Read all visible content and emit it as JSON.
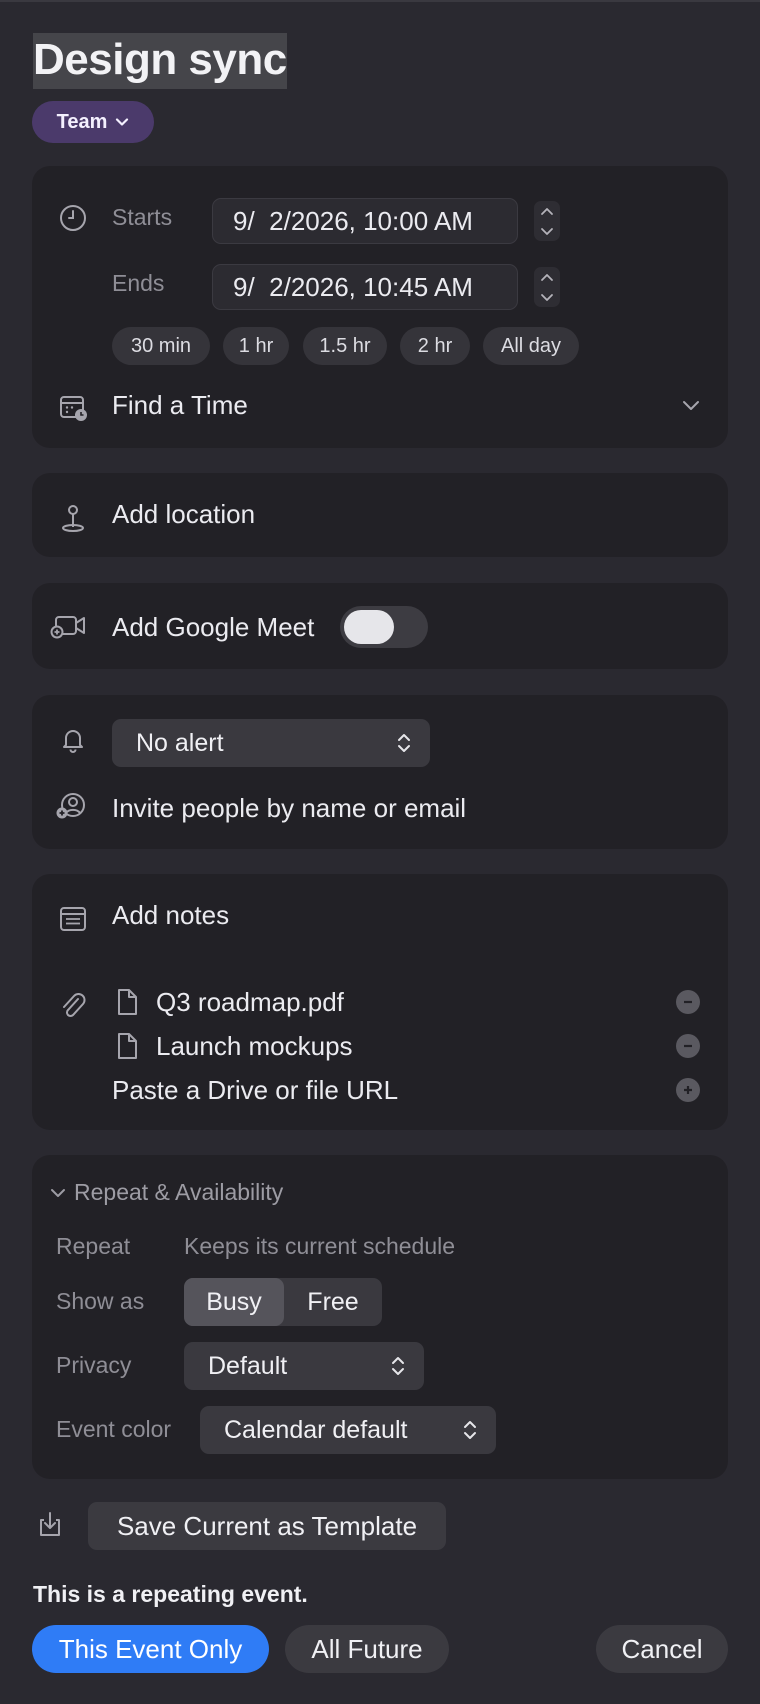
{
  "event": {
    "title": "Design sync",
    "calendar": "Team"
  },
  "time": {
    "starts_label": "Starts",
    "starts_value": "9/  2/2026, 10:00 AM",
    "ends_label": "Ends",
    "ends_value": "9/  2/2026, 10:45 AM",
    "duration_chips": [
      "30 min",
      "1 hr",
      "1.5 hr",
      "2 hr",
      "All day"
    ],
    "find_a_time": "Find a Time"
  },
  "location": {
    "placeholder": "Add location"
  },
  "conference": {
    "label": "Add Google Meet",
    "enabled": false
  },
  "alert": {
    "value": "No alert"
  },
  "invite": {
    "placeholder": "Invite people by name or email"
  },
  "notes": {
    "placeholder": "Add notes",
    "attachments": [
      "Q3 roadmap.pdf",
      "Launch mockups"
    ],
    "url_placeholder": "Paste a Drive or file URL"
  },
  "repeat": {
    "section_title": "Repeat & Availability",
    "repeat_label": "Repeat",
    "repeat_value": "Keeps its current schedule",
    "show_as_label": "Show as",
    "show_as_options": [
      "Busy",
      "Free"
    ],
    "show_as_selected": "Busy",
    "privacy_label": "Privacy",
    "privacy_value": "Default",
    "color_label": "Event color",
    "color_value": "Calendar default"
  },
  "template": {
    "save_label": "Save Current as Template"
  },
  "footer": {
    "notice": "This is a repeating event.",
    "this_event_only": "This Event Only",
    "all_future": "All Future",
    "cancel": "Cancel"
  },
  "colors": {
    "background": "#2a2930",
    "card": "#222126",
    "calendar_pill": "#4b3a6b",
    "primary": "#2f7cf6"
  }
}
